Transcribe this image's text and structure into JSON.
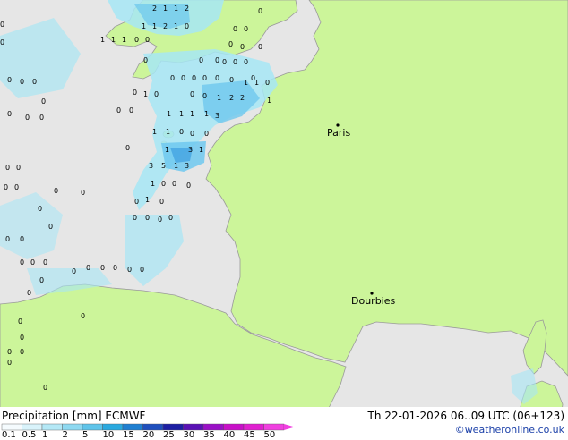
{
  "colors": {
    "sea": "#e6e6e6",
    "land": "#ccf59a",
    "coast": "#9a9a9a",
    "precip_light": "#a6e6f5",
    "precip_mid": "#6fc8ee",
    "precip_heavy": "#3c9ee0"
  },
  "cities": [
    {
      "name": "Paris"
    },
    {
      "name": "Dourbies"
    }
  ],
  "footer": {
    "title": "Precipitation [mm]  ECMWF",
    "valid_time": "Th 22-01-2026 06..09 UTC (06+123)",
    "credit": "©weatheronline.co.uk"
  },
  "legend": {
    "labels": [
      "0.1",
      "0.5",
      "1",
      "2",
      "5",
      "10",
      "15",
      "20",
      "25",
      "30",
      "35",
      "40",
      "45",
      "50"
    ],
    "colors": [
      "#f5fbfe",
      "#d9f3fb",
      "#b4e8f6",
      "#8ed9f1",
      "#5fc4ea",
      "#2aa9df",
      "#1f7fd1",
      "#1f4fbd",
      "#1d1fa3",
      "#5a12b5",
      "#9a10c6",
      "#c810c8",
      "#e020d0",
      "#f040e0"
    ]
  },
  "marks": [
    "0",
    "1",
    "2",
    "3",
    "5",
    "6"
  ]
}
